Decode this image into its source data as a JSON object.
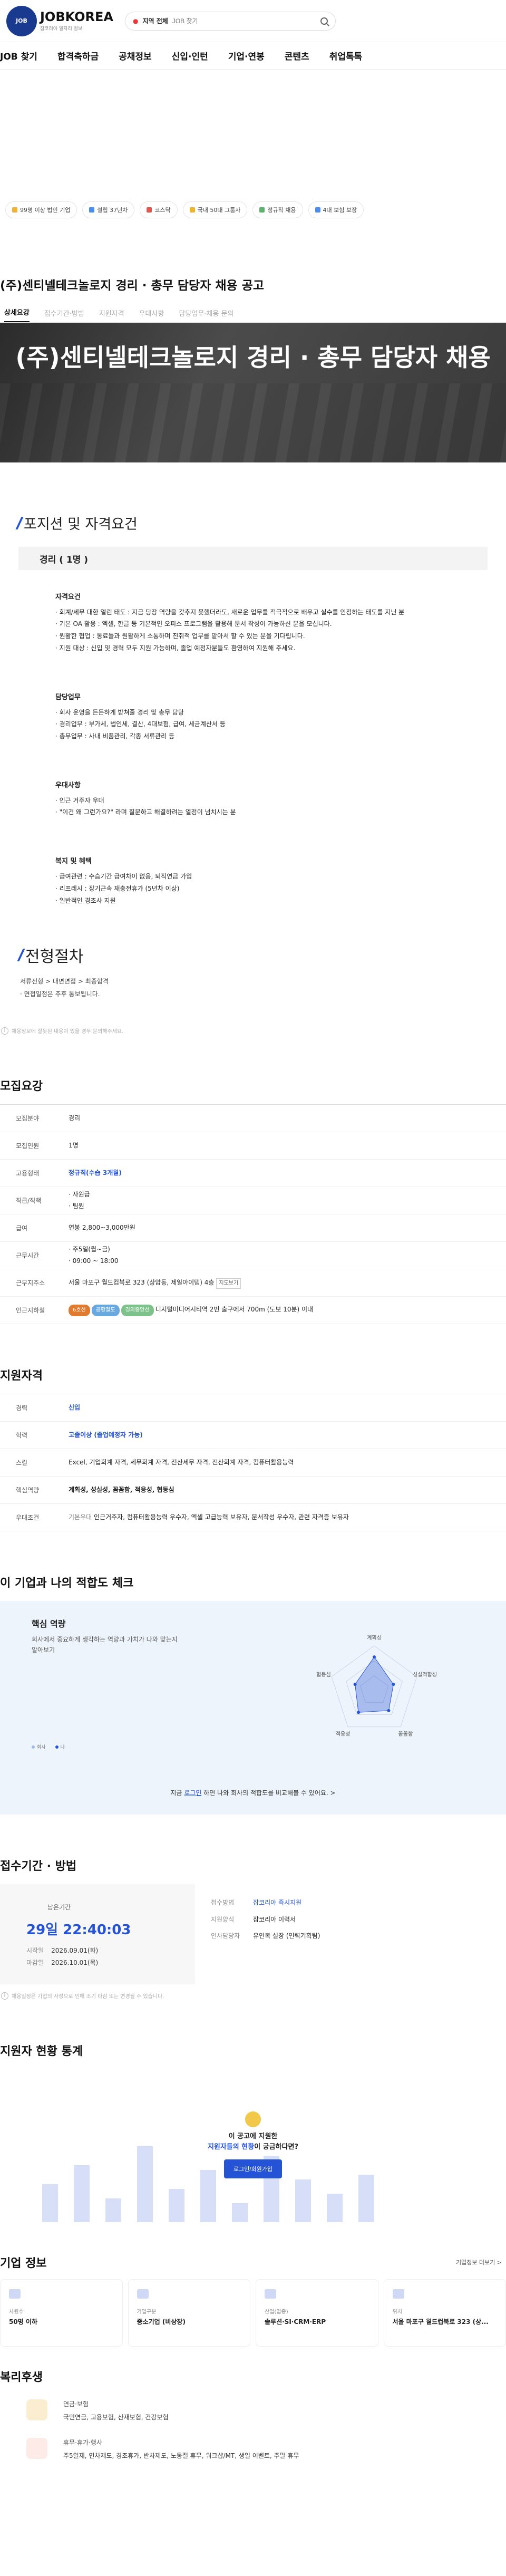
{
  "header": {
    "logo_text": "JOBKOREA",
    "logo_sub": "잡코리아 일자리 정보",
    "logo_badge": "JOB",
    "search_location": "지역 전체",
    "search_placeholder": "JOB 찾기"
  },
  "gnb": [
    "JOB 찾기",
    "합격축하금",
    "공채정보",
    "신입·인턴",
    "기업·연봉",
    "콘텐츠",
    "취업톡톡"
  ],
  "chips": [
    "99명 이상 법인 기업",
    "설립 37년차",
    "코스닥",
    "국내 50대 그룹사",
    "정규직 채용",
    "4대 보험 보장"
  ],
  "post": {
    "title": "(주)센티넬테크놀로지 경리 · 총무 담당자 채용 공고",
    "tabs": [
      "상세요강",
      "접수기간·방법",
      "지원자격",
      "우대사항",
      "담당업무·채용 문의"
    ],
    "hero_title": "(주)센티넬테크놀로지 경리 · 총무 담당자 채용"
  },
  "position": {
    "heading": "포지션 및 자격요건",
    "role": "경리 ( 1명 )",
    "blocks": [
      {
        "title": "자격요건",
        "items": [
          "· 회계/세무 대한 열린 태도 : 지금 당장 역량을 갖추지 못했더라도, 새로운 업무를 적극적으로 배우고 실수를 인정하는 태도를 지닌 분",
          "· 기본 OA 활용 : 엑셀, 한글 등 기본적인 오피스 프로그램을 활용해 문서 작성이 가능하신 분을 모십니다.",
          "· 원활한 협업 : 동료들과 원활하게 소통하며 진취적 업무를 맡아서 할 수 있는 분을 기다립니다.",
          "· 지원 대상 : 신입 및 경력 모두 지원 가능하며, 졸업 예정자분들도 환영하여 지원해 주세요."
        ]
      },
      {
        "title": "담당업무",
        "items": [
          "· 회사 운영을 든든하게 받쳐줄 경리 및 총무 담당",
          "· 경리업무 : 부가세, 법인세, 결산, 4대보험, 급여, 세금계산서 등",
          "· 총무업무 : 사내 비품관리, 각종 서류관리 등"
        ]
      },
      {
        "title": "우대사항",
        "items": [
          "· 인근 거주자 우대",
          "· \"이건 왜 그런가요?\" 라며 질문하고 해결하려는 열정이 넘치시는 분"
        ]
      },
      {
        "title": "복지 및 혜택",
        "items": [
          "· 급여관련 : 수습기간 급여차이 없음, 퇴직연금 가입",
          "· 리프레시 : 장기근속 재충전휴가 (5년차 이상)",
          "· 일반적인 경조사 지원"
        ]
      }
    ]
  },
  "process": {
    "heading": "전형절차",
    "lines": [
      "서류전형 > 대면면접 > 최종합격",
      "· 면접일정은 추후 통보됩니다."
    ]
  },
  "notice1": "채용정보에 잘못된 내용이 있을 경우 문의해주세요.",
  "recruit": {
    "heading": "모집요강",
    "rows": [
      {
        "k": "모집분야",
        "v": "경리"
      },
      {
        "k": "모집인원",
        "v": "1명"
      },
      {
        "k": "고용형태",
        "v": "정규직(수습 3개월)"
      },
      {
        "k": "직급/직책",
        "v": "· 사원급\n· 팀원"
      },
      {
        "k": "급여",
        "v": "연봉 2,800~3,000만원"
      },
      {
        "k": "근무시간",
        "v": "· 주5일(월~금)\n· 09:00 ~ 18:00"
      },
      {
        "k": "근무지주소",
        "v": "서울 마포구 월드컵북로 323 (상암동, 제일아이템) 4층",
        "btn": "지도보기"
      },
      {
        "k": "인근지하철",
        "v": "디지털미디어시티역 2번 출구에서 700m (도보 10분) 이내",
        "tags": [
          "6호선",
          "공항철도",
          "경의중앙선"
        ]
      }
    ]
  },
  "qual": {
    "heading": "지원자격",
    "rows": [
      {
        "k": "경력",
        "v": "신입"
      },
      {
        "k": "학력",
        "v": "고졸이상 (졸업예정자 가능)"
      },
      {
        "k": "스킬",
        "v": "Excel, 기업회계 자격, 세무회계 자격, 전산세무 자격, 전산회계 자격, 컴퓨터활용능력"
      },
      {
        "k": "핵심역량",
        "v": "계획성, 성실성, 꼼꼼함, 적응성, 협동심"
      },
      {
        "k": "우대조건",
        "v": "인근거주자, 컴퓨터활용능력 우수자, 엑셀 고급능력 보유자, 문서작성 우수자, 관련 자격증 보유자",
        "pre": "기본우대"
      }
    ]
  },
  "fit": {
    "heading": "이 기업과 나의 적합도 체크",
    "sub": "핵심 역량",
    "desc": "회사에서 중요하게 생각하는 역량과 가치가 나와 맞는지 알아보기",
    "legend": [
      "회사",
      "나"
    ],
    "axes": [
      "계획성",
      "성실적합성",
      "꼼꼼함",
      "적응성",
      "협동심"
    ],
    "values": [
      0.75,
      0.45,
      0.55,
      0.6,
      0.45
    ],
    "cta_pre": "지금 ",
    "cta_link": "로그인",
    "cta_post": " 하면 나와 회사의 적합도를 비교해볼 수 있어요. >"
  },
  "period": {
    "heading": "접수기간 · 방법",
    "left_label": "남은기간",
    "deadline": "29일 22:40:03",
    "start_k": "시작일",
    "start_v": "2026.09.01(화)",
    "end_k": "마감일",
    "end_v": "2026.10.01(목)",
    "rows": [
      {
        "k": "접수방법",
        "v": "잡코리아 즉시지원",
        "link": true
      },
      {
        "k": "지원양식",
        "v": "잡코리아 이력서"
      },
      {
        "k": "인사담당자",
        "v": "유연복 실장 (인력기획팀)"
      }
    ],
    "notice": "채용일정은 기업의 사정으로 인해 조기 마감 또는 변경될 수 있습니다."
  },
  "stats": {
    "heading": "지원자 현황 통계",
    "q1": "이 공고에 지원한",
    "q2a": "지원자들의 현황",
    "q2b": "이 궁금하다면?",
    "btn": "로그인/회원가입",
    "bars": [
      0.4,
      0.6,
      0.25,
      0.8,
      0.35,
      0.55,
      0.2,
      0.7,
      0.45,
      0.3,
      0.5
    ]
  },
  "company": {
    "heading": "기업 정보",
    "more": "기업정보 더보기 >",
    "cards": [
      {
        "lab": "사원수",
        "val": "50명 이하"
      },
      {
        "lab": "기업구분",
        "val": "중소기업 (비상장)"
      },
      {
        "lab": "산업(업종)",
        "val": "솔루션·SI·CRM·ERP"
      },
      {
        "lab": "위치",
        "val": "서울 마포구 월드컵북로 323 (상..."
      }
    ]
  },
  "benefit": {
    "heading": "복리후생",
    "rows": [
      {
        "h": "연금·보험",
        "v": "국민연금, 고용보험, 산재보험, 건강보험"
      },
      {
        "h": "휴무·휴가·행사",
        "v": "주5일제, 연차제도, 경조휴가, 반차제도, 노동절 휴무, 워크샵/MT, 생일 이벤트, 주말 휴무"
      }
    ]
  }
}
